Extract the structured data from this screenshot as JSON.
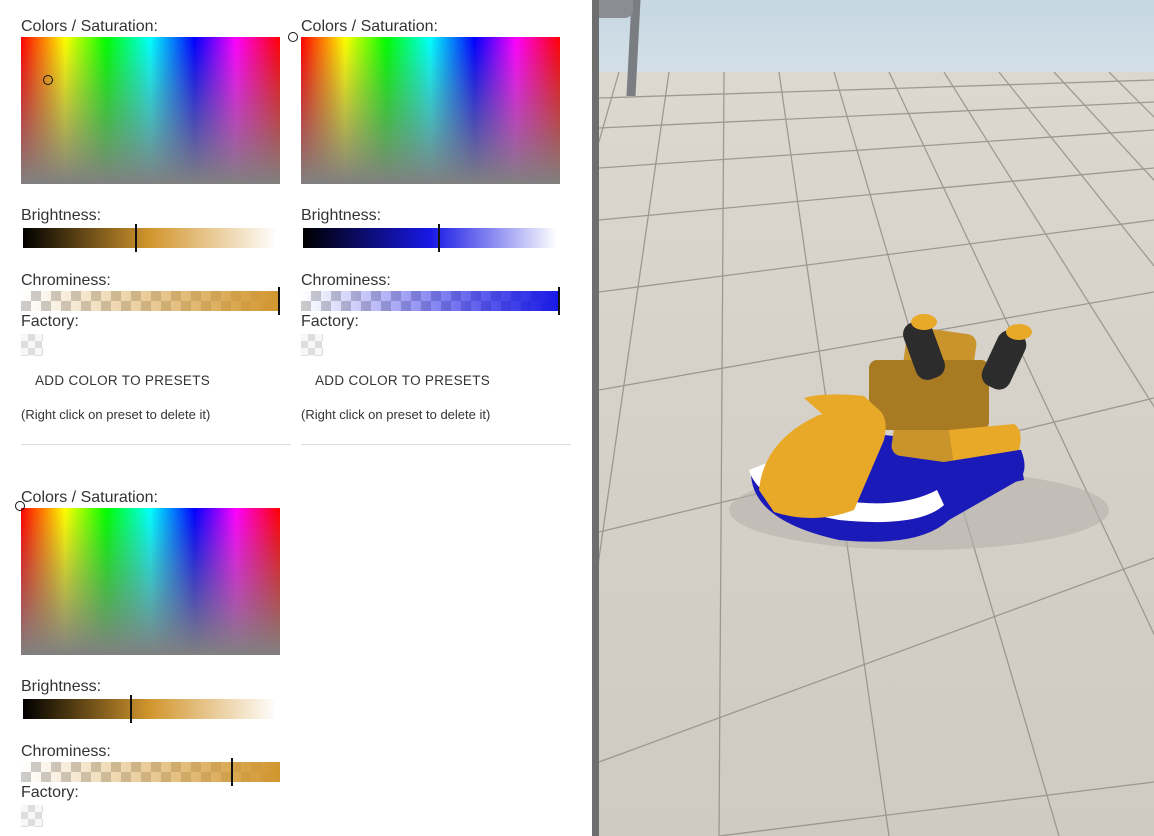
{
  "pickers": [
    {
      "colors_label": "Colors / Saturation:",
      "brightness_label": "Brightness:",
      "chrominess_label": "Chrominess:",
      "factory_label": "Factory:",
      "add_preset_label": "ADD COLOR TO PRESETS",
      "hint": "(Right click on preset to delete it)",
      "color": "#d2962e",
      "brightness_level": 0.44,
      "chrominess_level": 1.0
    },
    {
      "colors_label": "Colors / Saturation:",
      "brightness_label": "Brightness:",
      "chrominess_label": "Chrominess:",
      "factory_label": "Factory:",
      "add_preset_label": "ADD COLOR TO PRESETS",
      "hint": "(Right click on preset to delete it)",
      "color": "#1818e6",
      "brightness_level": 0.53,
      "chrominess_level": 1.0
    },
    {
      "colors_label": "Colors / Saturation:",
      "brightness_label": "Brightness:",
      "chrominess_label": "Chrominess:",
      "factory_label": "Factory:",
      "color": "#d2962e",
      "brightness_level": 0.42,
      "chrominess_level": 0.81
    }
  ],
  "colors": {
    "divider": "#6e6e6e",
    "kart_primary": "#e9a928",
    "kart_secondary": "#1a1ab8"
  }
}
